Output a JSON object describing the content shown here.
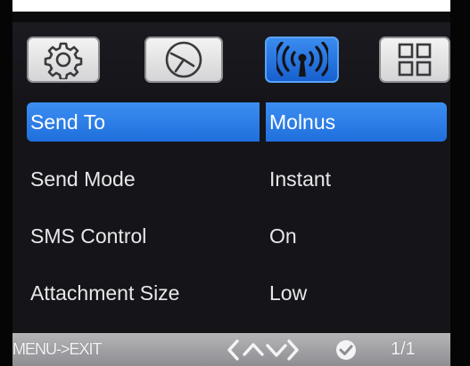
{
  "tabs": [
    {
      "icon": "gear-icon",
      "active": false
    },
    {
      "icon": "clock-icon",
      "active": false
    },
    {
      "icon": "wireless-signal-icon",
      "active": true
    },
    {
      "icon": "grid-icon",
      "active": false
    }
  ],
  "menu": {
    "rows": [
      {
        "label": "Send To",
        "value": "Molnus",
        "selected": true
      },
      {
        "label": "Send Mode",
        "value": "Instant",
        "selected": false
      },
      {
        "label": "SMS Control",
        "value": "On",
        "selected": false
      },
      {
        "label": "Attachment Size",
        "value": "Low",
        "selected": false
      }
    ]
  },
  "status": {
    "exit_hint": "MENU->EXIT",
    "page": "1/1",
    "nav_icons": "left-up-down-right-arrows-icon",
    "confirm_icon": "check-icon"
  },
  "colors": {
    "screen_bg": "#141419",
    "selection": "#2a7ae6",
    "active_tab": "#1f6fdc",
    "status_bar": "#a3a3a6"
  }
}
